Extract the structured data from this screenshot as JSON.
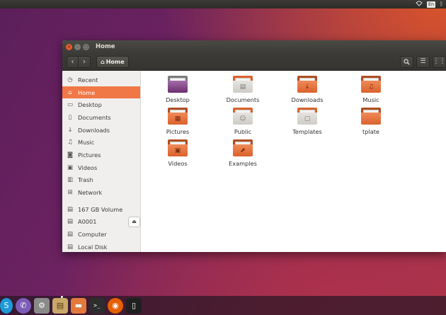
{
  "top_panel": {
    "keyboard_layout": "En",
    "icons": [
      "wifi-icon",
      "keyboard-layout-indicator",
      "bluetooth-icon"
    ]
  },
  "window": {
    "title": "Home",
    "buttons": [
      "close-icon",
      "minimize-icon",
      "maximize-icon"
    ]
  },
  "toolbar": {
    "back_glyph": "‹",
    "forward_glyph": "›",
    "path_label": "Home",
    "right_buttons": [
      "search-icon",
      "list-view-icon",
      "grid-view-icon"
    ]
  },
  "sidebar": {
    "places": [
      {
        "label": "Recent",
        "icon": "clock-icon",
        "active": false
      },
      {
        "label": "Home",
        "icon": "home-icon",
        "active": true
      },
      {
        "label": "Desktop",
        "icon": "folder-icon",
        "active": false
      },
      {
        "label": "Documents",
        "icon": "document-icon",
        "active": false
      },
      {
        "label": "Downloads",
        "icon": "download-icon",
        "active": false
      },
      {
        "label": "Music",
        "icon": "music-icon",
        "active": false
      },
      {
        "label": "Pictures",
        "icon": "camera-icon",
        "active": false
      },
      {
        "label": "Videos",
        "icon": "video-icon",
        "active": false
      },
      {
        "label": "Trash",
        "icon": "trash-icon",
        "active": false
      },
      {
        "label": "Network",
        "icon": "network-icon",
        "active": false
      }
    ],
    "devices": [
      {
        "label": "167 GB Volume",
        "icon": "drive-icon",
        "eject": false
      },
      {
        "label": "A0001",
        "icon": "drive-icon",
        "eject": true
      },
      {
        "label": "Computer",
        "icon": "drive-icon",
        "eject": false
      },
      {
        "label": "Local Disk",
        "icon": "drive-icon",
        "eject": false
      }
    ]
  },
  "files": [
    {
      "label": "Desktop",
      "type": "desktop"
    },
    {
      "label": "Documents",
      "type": "doc"
    },
    {
      "label": "Downloads",
      "type": "download"
    },
    {
      "label": "Music",
      "type": "music"
    },
    {
      "label": "Pictures",
      "type": "pictures"
    },
    {
      "label": "Public",
      "type": "pub"
    },
    {
      "label": "Templates",
      "type": "tpl"
    },
    {
      "label": "tplate",
      "type": "plain"
    },
    {
      "label": "Videos",
      "type": "videos"
    },
    {
      "label": "Examples",
      "type": "examples"
    }
  ],
  "launcher": [
    {
      "name": "skype-icon",
      "glyph": "S"
    },
    {
      "name": "viber-icon",
      "glyph": "✆"
    },
    {
      "name": "settings-icon",
      "glyph": "⚙"
    },
    {
      "name": "files-icon",
      "glyph": "▤"
    },
    {
      "name": "folder-icon",
      "glyph": "▬"
    },
    {
      "name": "terminal-icon",
      "glyph": ">_"
    },
    {
      "name": "firefox-icon",
      "glyph": "◉"
    },
    {
      "name": "device-icon",
      "glyph": "▯"
    }
  ],
  "colors": {
    "accent": "#f07746",
    "panel": "#3c3b37"
  }
}
